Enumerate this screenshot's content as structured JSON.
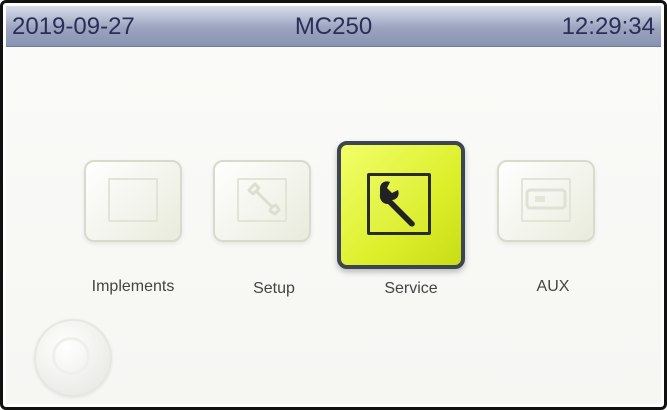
{
  "header": {
    "date": "2019-09-27",
    "title": "MC250",
    "time": "12:29:34"
  },
  "menu": {
    "items": [
      {
        "id": "implements",
        "label": "Implements",
        "icon": "implements-icon",
        "active": false
      },
      {
        "id": "setup",
        "label": "Setup",
        "icon": "wrench-icon",
        "active": false
      },
      {
        "id": "service",
        "label": "Service",
        "icon": "wrench-icon",
        "active": true
      },
      {
        "id": "aux",
        "label": "AUX",
        "icon": "aux-icon",
        "active": false
      }
    ]
  },
  "colors": {
    "header_bg": "#9aa4bf",
    "header_text": "#2a2f5a",
    "active_tile": "#dcef2a",
    "active_border": "#3d4550"
  }
}
